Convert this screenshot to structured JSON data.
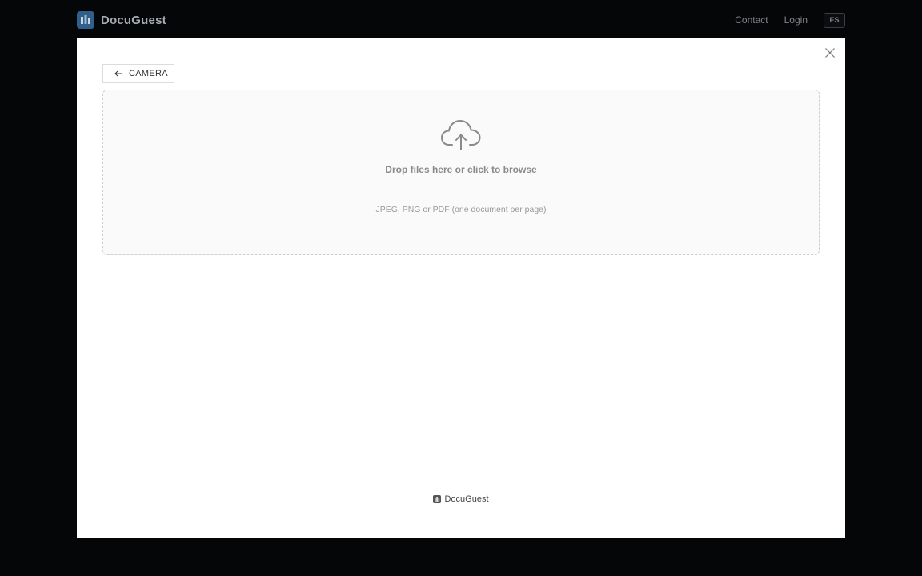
{
  "header": {
    "brand": "DocuGuest",
    "nav": [
      {
        "label": "Contact"
      },
      {
        "label": "Login"
      }
    ],
    "lang_button": "ES"
  },
  "modal": {
    "back_button": "CAMERA",
    "dropzone": {
      "title": "Drop files here or click to browse",
      "hint": "JPEG, PNG or PDF (one document per page)"
    },
    "footer_brand": "DocuGuest"
  },
  "icons": {
    "brand_logo": "document-stack-icon",
    "close": "close-icon",
    "back": "arrow-left-icon",
    "upload": "cloud-upload-icon",
    "footer_logo": "document-stack-icon"
  },
  "colors": {
    "background": "#050608",
    "brand_logo": "#2f5f8a",
    "modal": "#ffffff",
    "dropzone": "#fafafa"
  }
}
